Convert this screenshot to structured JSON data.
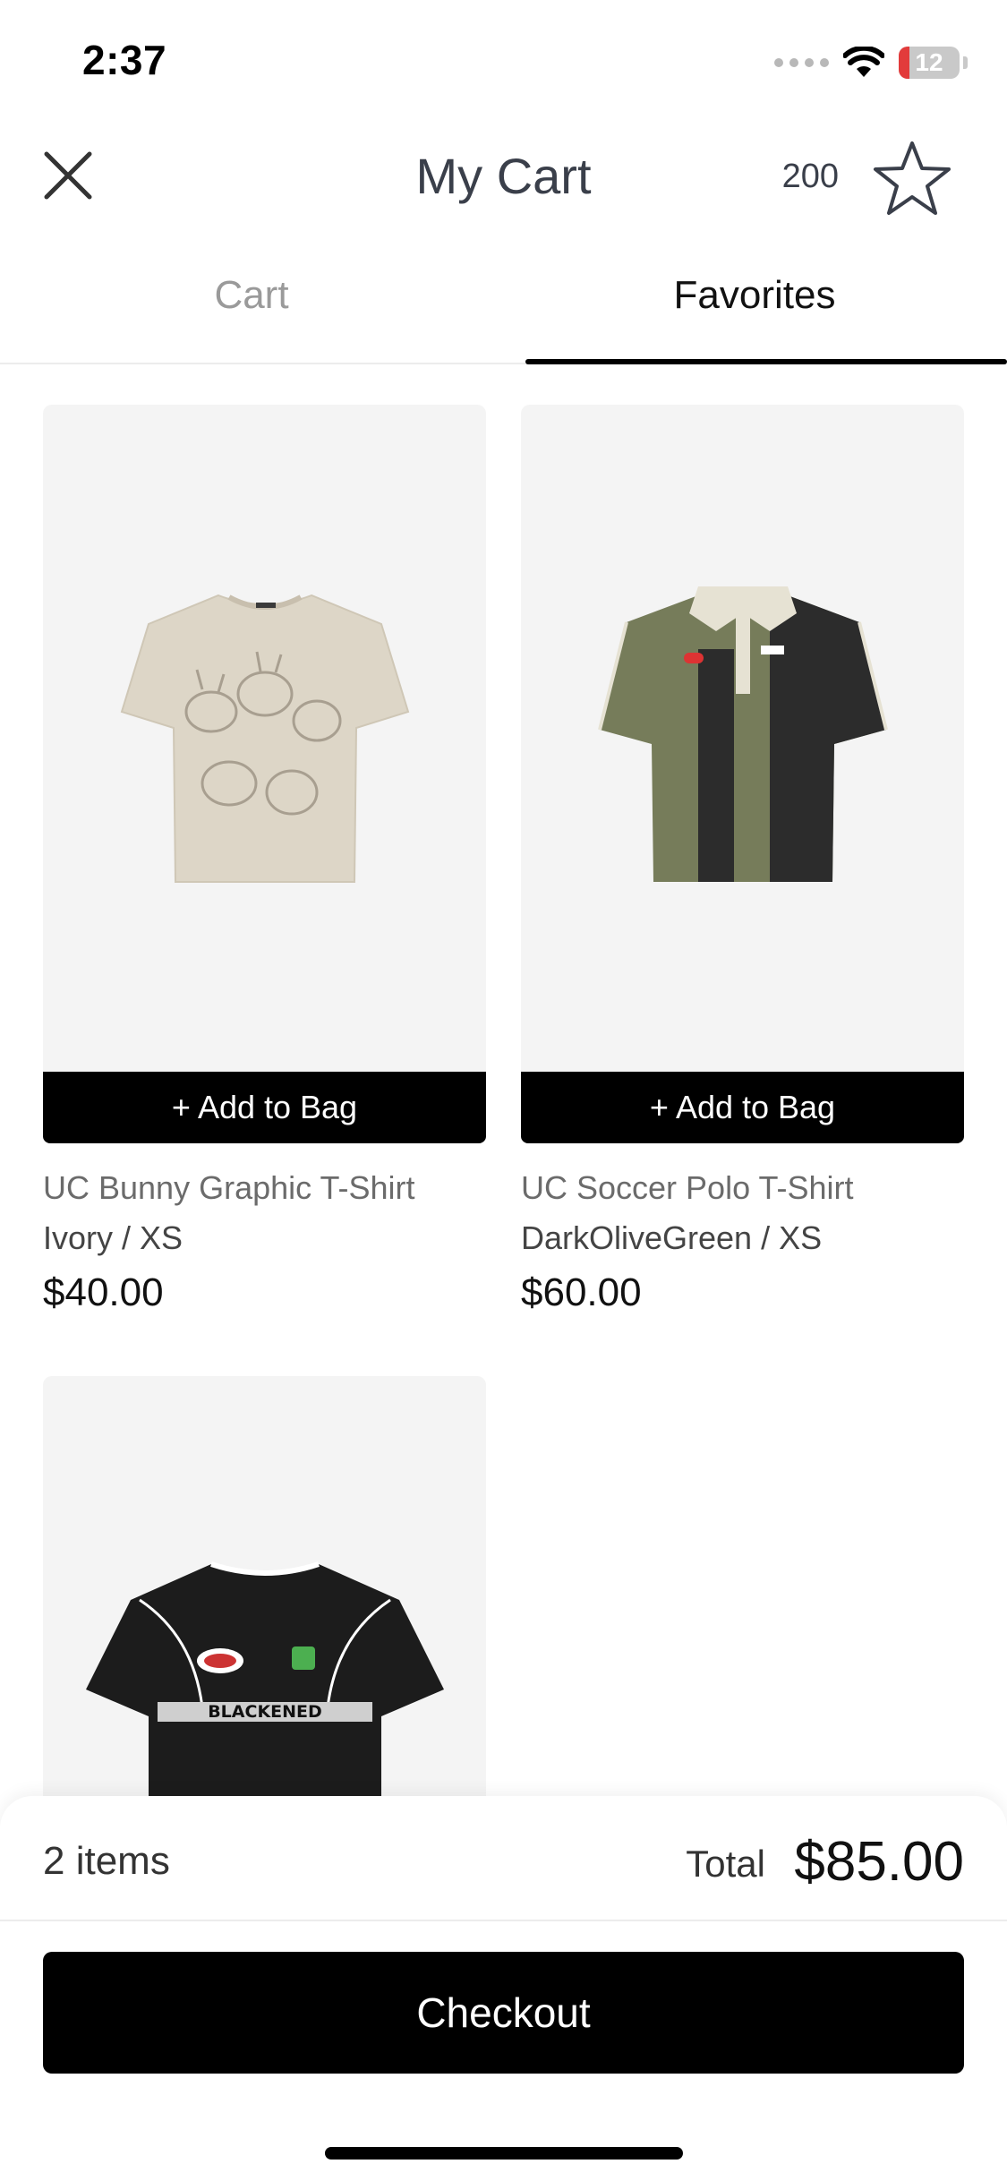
{
  "status_bar": {
    "time": "2:37",
    "battery": "12"
  },
  "header": {
    "title": "My Cart",
    "favorites_count": "200"
  },
  "tabs": [
    {
      "label": "Cart",
      "selected": false
    },
    {
      "label": "Favorites",
      "selected": true
    }
  ],
  "products": [
    {
      "name": "UC Bunny Graphic T-Shirt",
      "variant": "Ivory / XS",
      "price": "$40.00",
      "button": "+ Add to Bag"
    },
    {
      "name": "UC Soccer Polo T-Shirt",
      "variant": "DarkOliveGreen / XS",
      "price": "$60.00",
      "button": "+ Add to Bag"
    },
    {
      "graphic_text": "BLACKENED"
    }
  ],
  "summary": {
    "items": "2 items",
    "total_label": "Total",
    "total_value": "$85.00"
  },
  "checkout": {
    "label": "Checkout"
  },
  "colors": {
    "accent": "#000000",
    "battery_low": "#e23b3b",
    "image_bg": "#f4f4f4"
  }
}
